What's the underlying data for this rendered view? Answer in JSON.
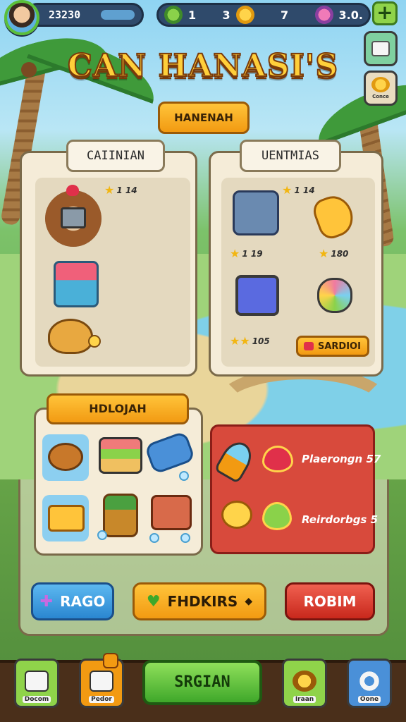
{
  "hud": {
    "player_coins": "23230",
    "resources": [
      {
        "icon": "clover-icon",
        "value": "1"
      },
      {
        "icon": "coin-icon",
        "value": "3"
      },
      {
        "icon": "coin-icon",
        "value": "7"
      },
      {
        "icon": "gem-icon",
        "value": "3.0."
      }
    ],
    "plus_label": "+"
  },
  "side_buttons": [
    {
      "icon": "shop-icon",
      "label": ""
    },
    {
      "icon": "coins-icon",
      "label": "Conce"
    }
  ],
  "title": "CAN HANASI'S",
  "subtitle_button": "HANENAH",
  "left_card": {
    "tab": "CAIINIAN",
    "items": [
      {
        "icon": "shield-log-icon",
        "stat": "1 14"
      },
      {
        "icon": "crate-icon",
        "stat": ""
      },
      {
        "icon": "critter-icon",
        "stat": ""
      }
    ]
  },
  "right_card": {
    "tab": "UENTMIAS",
    "items": [
      {
        "icon": "bag-icon",
        "stat": "1 19"
      },
      {
        "icon": "banana-icon",
        "stat": "180"
      },
      {
        "icon": "monitor-icon",
        "stat": "105"
      },
      {
        "icon": "gem-cluster-icon",
        "stat": ""
      }
    ],
    "top_stat": "1 14",
    "button": "SARDIOI"
  },
  "bottom_left_card": {
    "tab": "HDLOJAH",
    "slots": [
      "sausage-icon",
      "cake-icon",
      "cannon-icon",
      "butter-icon",
      "plant-pot-icon",
      "treasure-chest-icon"
    ]
  },
  "red_card": {
    "rows": [
      {
        "icon": "heart-icon",
        "label": "Plaerongn 57"
      },
      {
        "icon": "heart-icon",
        "label": "Reirdorbgs 5"
      }
    ]
  },
  "actions": {
    "blue": "RAGO",
    "orange": "FHDKIRS",
    "red": "ROBIM"
  },
  "nav": [
    {
      "icon": "house-icon",
      "label": "Docom"
    },
    {
      "icon": "hat-icon",
      "label": "Pedor"
    },
    {
      "icon": "gear-icon",
      "label": "Iraan"
    },
    {
      "icon": "target-icon",
      "label": "Oone"
    }
  ],
  "nav_center": "SRGIAN"
}
